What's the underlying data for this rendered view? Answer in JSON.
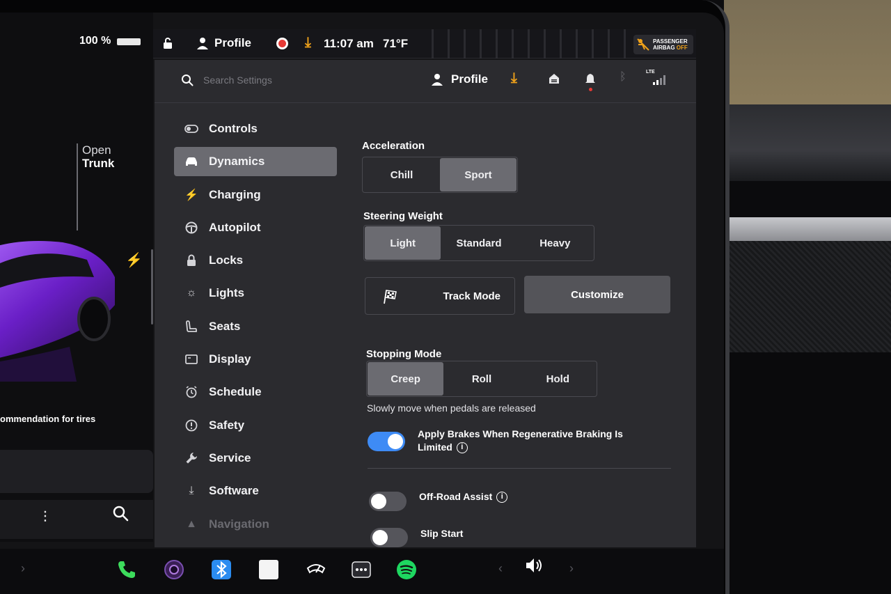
{
  "car_panel": {
    "battery": "100 %",
    "open_label": "Open",
    "trunk_label": "Trunk",
    "tire_text": "ommendation for tires"
  },
  "status_bar": {
    "profile": "Profile",
    "time": "11:07 am",
    "temperature": "71°F",
    "airbag_line1": "PASSENGER",
    "airbag_line2": "AIRBAG",
    "airbag_state": "OFF"
  },
  "header": {
    "search_placeholder": "Search Settings",
    "profile": "Profile",
    "network": "LTE"
  },
  "nav": {
    "items": [
      {
        "label": "Controls",
        "icon": "toggle-icon"
      },
      {
        "label": "Dynamics",
        "icon": "car-icon",
        "active": true
      },
      {
        "label": "Charging",
        "icon": "bolt-icon"
      },
      {
        "label": "Autopilot",
        "icon": "steering-wheel-icon"
      },
      {
        "label": "Locks",
        "icon": "lock-icon"
      },
      {
        "label": "Lights",
        "icon": "sun-icon"
      },
      {
        "label": "Seats",
        "icon": "seat-icon"
      },
      {
        "label": "Display",
        "icon": "display-icon"
      },
      {
        "label": "Schedule",
        "icon": "alarm-clock-icon"
      },
      {
        "label": "Safety",
        "icon": "alert-circle-icon"
      },
      {
        "label": "Service",
        "icon": "wrench-icon"
      },
      {
        "label": "Software",
        "icon": "download-icon"
      },
      {
        "label": "Navigation",
        "icon": "navigation-arrow-icon"
      }
    ]
  },
  "dynamics": {
    "acceleration": {
      "label": "Acceleration",
      "options": [
        "Chill",
        "Sport"
      ],
      "selected": "Sport"
    },
    "steering": {
      "label": "Steering Weight",
      "options": [
        "Light",
        "Standard",
        "Heavy"
      ],
      "selected": "Light"
    },
    "track_mode": "Track Mode",
    "customize": "Customize",
    "stopping": {
      "label": "Stopping Mode",
      "options": [
        "Creep",
        "Roll",
        "Hold"
      ],
      "selected": "Creep"
    },
    "stopping_hint": "Slowly move when pedals are released",
    "apply_brakes": {
      "label": "Apply Brakes When Regenerative Braking Is Limited",
      "on": true
    },
    "off_road": {
      "label": "Off-Road Assist",
      "on": false
    },
    "slip_start": {
      "label": "Slip Start",
      "on": false
    }
  },
  "colors": {
    "accent_blue": "#3e8bf5",
    "warning_orange": "#f0a21a",
    "record_red": "#e53935",
    "car_purple": "#7a2bd6"
  }
}
